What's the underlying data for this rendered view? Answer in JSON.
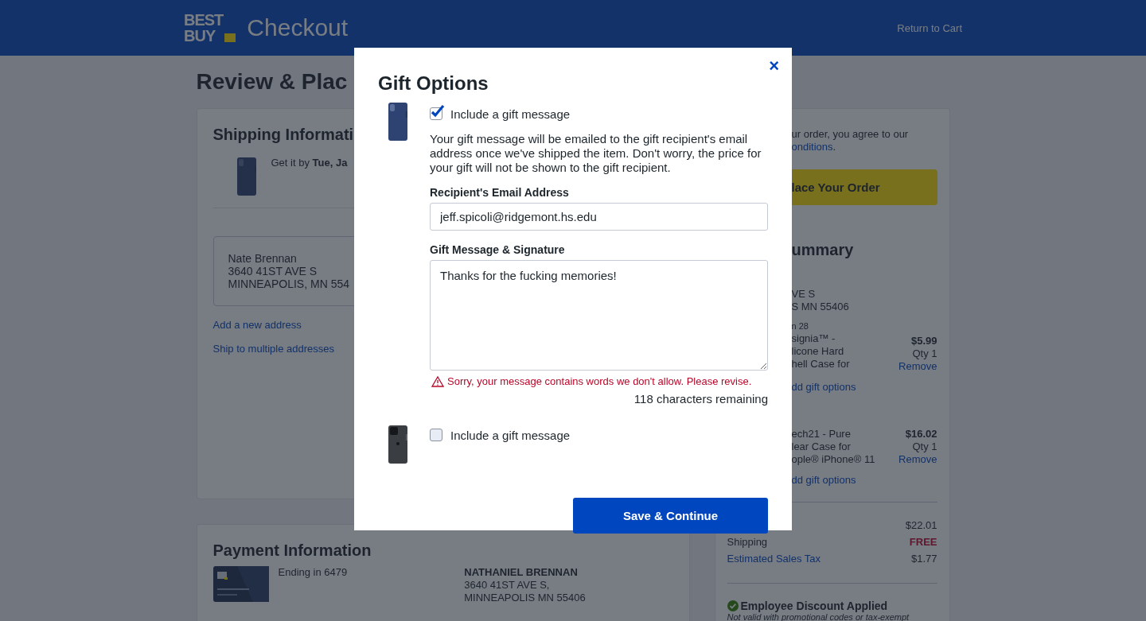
{
  "header": {
    "logo_top": "BEST",
    "logo_bottom": "BUY",
    "title": "Checkout",
    "return_link": "Return to Cart"
  },
  "page_title": "Review & Plac",
  "shipping": {
    "title": "Shipping Informati",
    "delivery": "Get it by **Tue, Ja**",
    "address_lines": [
      "Nate Brennan",
      "3640 41ST AVE S",
      "MINNEAPOLIS, MN 554"
    ],
    "links": [
      "Add a new address",
      "Ship to multiple addresses"
    ]
  },
  "payment": {
    "title": "Payment Information",
    "card_ending": "Ending in 6479",
    "name": "NATHANIEL BRENNAN",
    "address_lines": [
      "3640 41ST AVE S,",
      "MINNEAPOLIS MN 55406"
    ]
  },
  "summary": {
    "terms": "ur order, you agree to our",
    "terms_link": "onditions",
    "terms_end": ".",
    "place_order": "lace Your Order",
    "title": "ummary",
    "address_lines": [
      "VE S",
      "S MN 55406"
    ],
    "items": [
      {
        "date": "n 28",
        "name_lines": [
          "signia™ -",
          "licone Hard",
          "hell Case for"
        ],
        "price": "$5.99",
        "qty": "Qty 1",
        "remove": "Remove",
        "gift_link": "dd gift options"
      },
      {
        "name_lines": [
          "ech21 - Pure",
          "lear Case for",
          "ople® iPhone® 11"
        ],
        "price": "$16.02",
        "qty": "Qty 1",
        "remove": "Remove",
        "gift_link": "dd gift options"
      }
    ],
    "totals": [
      {
        "kind": "plain",
        "value": "$22.01"
      },
      {
        "kind": "free",
        "label": "Shipping",
        "value": "FREE"
      },
      {
        "kind": "link",
        "label": "Estimated Sales Tax",
        "value": "$1.77"
      }
    ],
    "discount": {
      "title": "Employee Discount Applied",
      "note": "Not valid with promotional codes or tax-exempt"
    }
  },
  "modal": {
    "title": "Gift Options",
    "close": "×",
    "products": [
      {
        "kind": "case",
        "checked": true,
        "label": "Include a gift message",
        "details": {
          "description": "Your gift message will be emailed to the gift recipient's email address once we've shipped the item. Don't worry, the price for your gift will not be shown to the gift recipient.",
          "email_label": "Recipient's Email Address",
          "email_value": "jeff.spicoli@ridgemont.hs.edu",
          "message_label": "Gift Message & Signature",
          "message_value": "Thanks for the fucking memories!",
          "error": "Sorry, your message contains words we don't allow. Please revise.",
          "remaining": "118 characters remaining"
        }
      },
      {
        "kind": "phone",
        "checked": false,
        "label": "Include a gift message"
      }
    ],
    "save_button": "Save & Continue"
  }
}
